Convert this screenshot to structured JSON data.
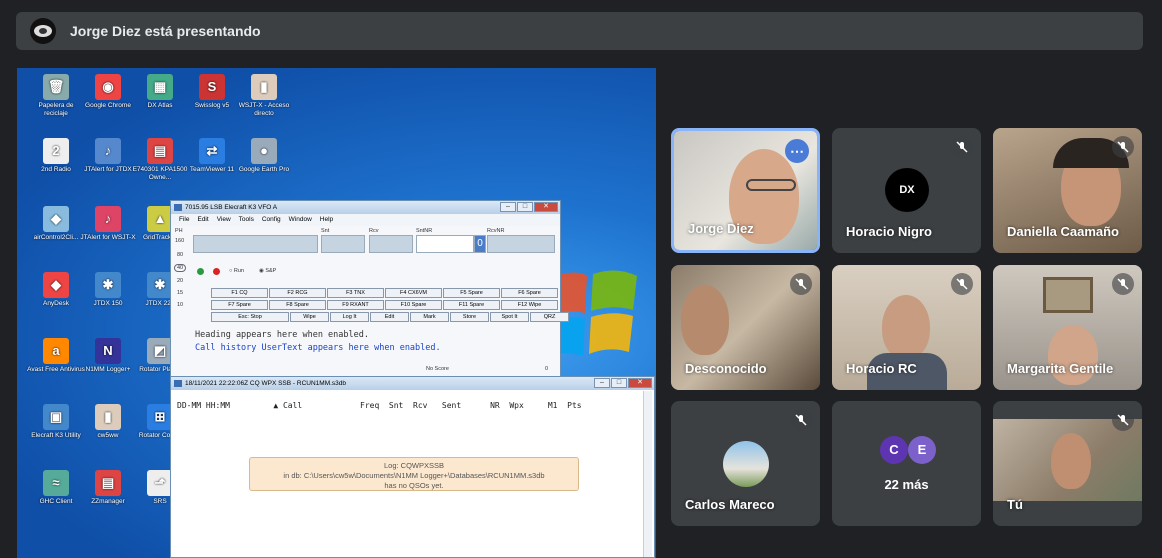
{
  "presenting_banner": {
    "text": "Jorge Diez está presentando"
  },
  "desktop": {
    "icons": [
      {
        "label": "Papelera de reciclaje",
        "glyph": "🗑",
        "color": "#8aa"
      },
      {
        "label": "Google Chrome",
        "glyph": "◉",
        "color": "#e44"
      },
      {
        "label": "DX Atlas",
        "glyph": "▦",
        "color": "#4a8"
      },
      {
        "label": "Swisslog v5",
        "glyph": "S",
        "color": "#c33"
      },
      {
        "label": "WSJT-X - Acceso directo",
        "glyph": "▮",
        "color": "#dcb"
      },
      {
        "label": "2nd Radio",
        "glyph": "2",
        "color": "#eee"
      },
      {
        "label": "JTAlert for JTDX",
        "glyph": "♪",
        "color": "#58c"
      },
      {
        "label": "E740301 KPA1500 Owne...",
        "glyph": "▤",
        "color": "#d44"
      },
      {
        "label": "TeamViewer 11",
        "glyph": "⇄",
        "color": "#2a7de1"
      },
      {
        "label": "Google Earth Pro",
        "glyph": "●",
        "color": "#9ab"
      },
      {
        "label": "airControl2Cli...",
        "glyph": "◆",
        "color": "#8bd"
      },
      {
        "label": "JTAlert for WSJT-X",
        "glyph": "♪",
        "color": "#d46"
      },
      {
        "label": "GridTracker",
        "glyph": "▲",
        "color": "#cc4"
      },
      {
        "label": "AnyDesk",
        "glyph": "◆",
        "color": "#e44"
      },
      {
        "label": "JTDX 150",
        "glyph": "✱",
        "color": "#48c"
      },
      {
        "label": "JTDX 220",
        "glyph": "✱",
        "color": "#48c"
      },
      {
        "label": "Avast Free Antivirus",
        "glyph": "a",
        "color": "#f80"
      },
      {
        "label": "N1MM Logger+",
        "glyph": "N",
        "color": "#339"
      },
      {
        "label": "Rotator Player",
        "glyph": "◩",
        "color": "#9ab"
      },
      {
        "label": "Elecraft K3 Utility",
        "glyph": "▣",
        "color": "#48c"
      },
      {
        "label": "cw5ww",
        "glyph": "▮",
        "color": "#dcb"
      },
      {
        "label": "Rotator Cont...",
        "glyph": "⊞",
        "color": "#2a7de1"
      },
      {
        "label": "GHC Client",
        "glyph": "≈",
        "color": "#5a9"
      },
      {
        "label": "ZZmanager",
        "glyph": "▤",
        "color": "#d44"
      },
      {
        "label": "SRS",
        "glyph": "⬏",
        "color": "#eee"
      }
    ]
  },
  "entry_window": {
    "title": "7015.95 LSB Elecraft K3 VFO A",
    "menu": [
      "File",
      "Edit",
      "View",
      "Tools",
      "Config",
      "Window",
      "Help"
    ],
    "field_labels": [
      "PH",
      "Snt",
      "Rcv",
      "SntNR",
      "RcvNR"
    ],
    "band_labels": [
      "160",
      "80",
      "40",
      "20",
      "15",
      "10"
    ],
    "run_label": "Run",
    "sp_label": "S&P",
    "sntnr_value": "0",
    "buttons_row1": [
      "F1 CQ",
      "F2 RCG",
      "F3 TNX",
      "F4 CX6VM",
      "F5 Spare",
      "F6 Spare"
    ],
    "buttons_row2": [
      "F7 Spare",
      "F8 Spare",
      "F9 RXANT",
      "F10 Spare",
      "F11 Spare",
      "F12 Wipe"
    ],
    "buttons_row3": [
      "Esc: Stop",
      "Wipe",
      "Log It",
      "Edit",
      "Mark",
      "Store",
      "Spot It",
      "QRZ"
    ],
    "heading_text": "Heading appears here when enabled.",
    "call_history_text": "Call history UserText appears here when enabled.",
    "status_left": "No Score",
    "status_right": "0"
  },
  "log_window": {
    "title": "18/11/2021 22:22:06Z  CQ WPX SSB - RCUN1MM.s3db",
    "header": "DD-MM HH:MM         ▲ Call            Freq  Snt  Rcv   Sent      NR  Wpx     M1  Pts",
    "message": [
      "Log: CQWPXSSB",
      "in db: C:\\Users\\cw5w\\Documents\\N1MM Logger+\\Databases\\RCUN1MM.s3db",
      "has no QSOs yet."
    ]
  },
  "participants": [
    {
      "name": "Jorge Diez"
    },
    {
      "name": "Horacio Nigro"
    },
    {
      "name": "Daniella Caamaño"
    },
    {
      "name": "Desconocido"
    },
    {
      "name": "Horacio RC"
    },
    {
      "name": "Margarita Gentile"
    },
    {
      "name": "Carlos Mareco"
    },
    {
      "name": "22 más",
      "initials": [
        "C",
        "E"
      ]
    },
    {
      "name": "Tú"
    }
  ],
  "colors": {
    "speaking_border": "#8ab4f8",
    "tile_bg": "#3c4043",
    "avatar_c": "#5e35b1",
    "avatar_e": "#7b61c9"
  }
}
